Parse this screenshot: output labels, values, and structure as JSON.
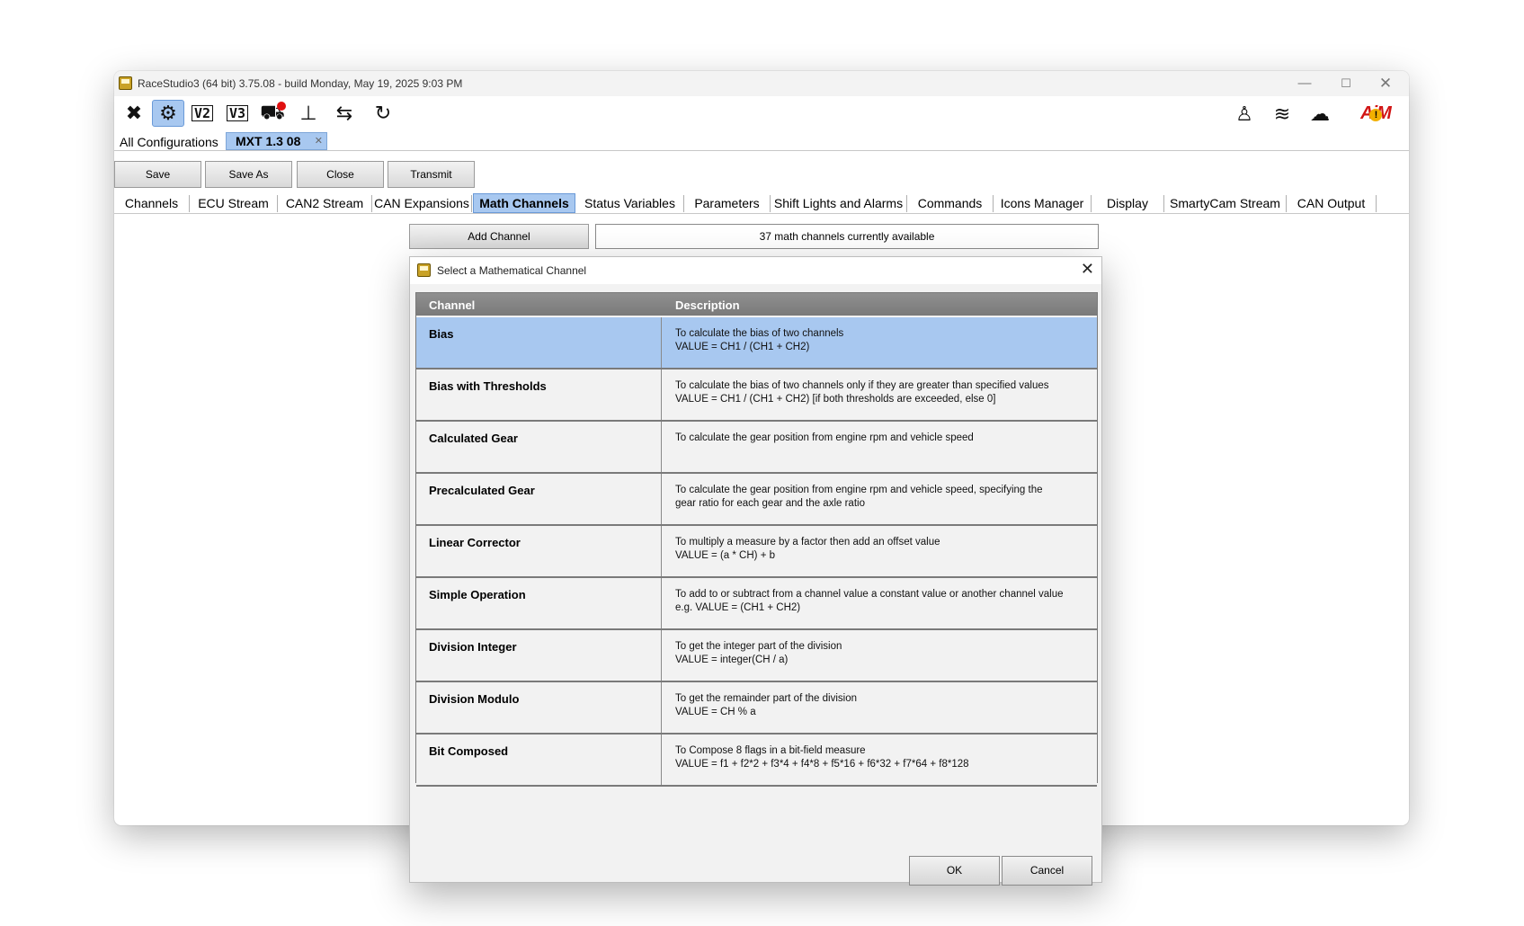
{
  "window": {
    "title": "RaceStudio3 (64 bit) 3.75.08 - build Monday, May 19, 2025 9:03 PM",
    "controls": {
      "minimize": "—",
      "maximize": "☐",
      "close": "✕"
    }
  },
  "toolbar": {
    "icons": [
      {
        "name": "tools-icon",
        "glyph": "✖"
      },
      {
        "name": "device-settings-icon",
        "glyph": "⚙"
      },
      {
        "name": "v2-icon",
        "glyph": "V2"
      },
      {
        "name": "v3-icon",
        "glyph": "V3"
      },
      {
        "name": "track-icon",
        "glyph": "⛟"
      },
      {
        "name": "fuel-level-icon",
        "glyph": "⊥"
      },
      {
        "name": "transfer-add-icon",
        "glyph": "⇆"
      },
      {
        "name": "sync-icon",
        "glyph": "↻"
      }
    ],
    "right_icons": [
      {
        "name": "user-icon",
        "glyph": "♙"
      },
      {
        "name": "wifi-icon",
        "glyph": "≋"
      },
      {
        "name": "cloud-download-icon",
        "glyph": "☁"
      }
    ],
    "logo_text": "AiM",
    "logo_warning": "!"
  },
  "config_tabs": {
    "all_label": "All Configurations",
    "active_label": "MXT 1.3 08",
    "active_close": "✕"
  },
  "actions": {
    "save": "Save",
    "save_as": "Save As",
    "close": "Close",
    "transmit": "Transmit"
  },
  "main_tabs": [
    "Channels",
    "ECU Stream",
    "CAN2 Stream",
    "CAN Expansions",
    "Math Channels",
    "Status Variables",
    "Parameters",
    "Shift Lights and Alarms",
    "Commands",
    "Icons Manager",
    "Display",
    "SmartyCam Stream",
    "CAN Output"
  ],
  "math": {
    "add_channel": "Add Channel",
    "available_text": "37 math channels currently available"
  },
  "dialog": {
    "title": "Select a Mathematical Channel",
    "close": "✕",
    "columns": {
      "channel": "Channel",
      "description": "Description"
    },
    "rows": [
      {
        "name": "Bias",
        "desc1": "To calculate the bias of two channels",
        "desc2": "VALUE = CH1 / (CH1 + CH2)"
      },
      {
        "name": "Bias with Thresholds",
        "desc1": "To calculate the bias of two channels only if they are greater than specified values",
        "desc2": "VALUE = CH1 / (CH1 + CH2) [if both thresholds are exceeded, else 0]"
      },
      {
        "name": "Calculated Gear",
        "desc1": "To calculate the gear position from engine rpm and vehicle speed",
        "desc2": ""
      },
      {
        "name": "Precalculated Gear",
        "desc1": "To calculate the gear position from engine rpm and vehicle speed, specifying the",
        "desc2": "gear ratio for each gear and the axle ratio"
      },
      {
        "name": "Linear Corrector",
        "desc1": "To multiply a measure by a factor then add an offset value",
        "desc2": "VALUE = (a * CH) + b"
      },
      {
        "name": "Simple Operation",
        "desc1": "To add to or subtract from a channel value a constant value or another channel value",
        "desc2": "e.g. VALUE = (CH1 + CH2)"
      },
      {
        "name": "Division Integer",
        "desc1": "To get the integer part of the division",
        "desc2": "VALUE = integer(CH / a)"
      },
      {
        "name": "Division Modulo",
        "desc1": "To get the remainder part of the division",
        "desc2": "VALUE = CH % a"
      },
      {
        "name": "Bit Composed",
        "desc1": "To Compose 8 flags in a bit-field measure",
        "desc2": "VALUE = f1 + f2*2 + f3*4 + f4*8 + f5*16 + f6*32 + f7*64 + f8*128"
      }
    ],
    "ok": "OK",
    "cancel": "Cancel"
  }
}
